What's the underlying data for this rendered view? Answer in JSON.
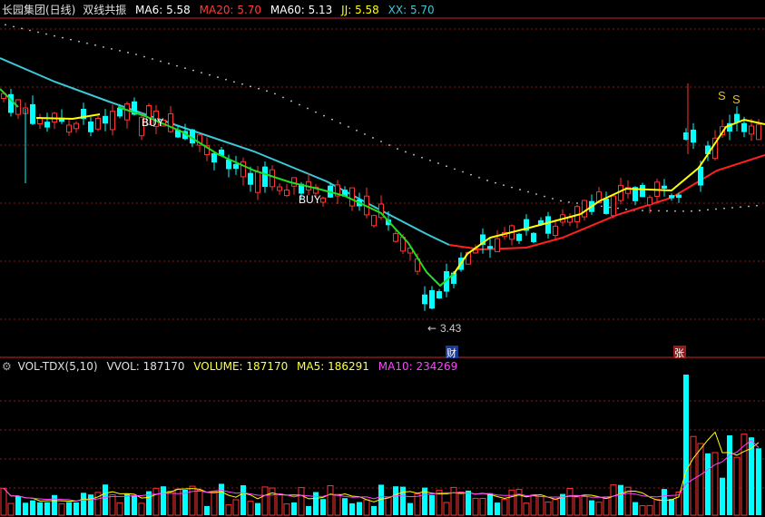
{
  "price_panel": {
    "stock_name": "长园集团(日线)",
    "indicator_name": "双线共振",
    "ma6": {
      "label": "MA6: 5.58",
      "color": "#ffffff"
    },
    "ma20": {
      "label": "MA20: 5.70",
      "color": "#ff3b3b"
    },
    "ma60": {
      "label": "MA60: 5.13",
      "color": "#ffffff"
    },
    "jj": {
      "label": "JJ: 5.58",
      "color": "#ffff00"
    },
    "xx": {
      "label": "XX: 5.70",
      "color": "#3cc8d8"
    },
    "low_marker": "3.43",
    "buy_label_1": "BUY",
    "buy_label_2": "BUY",
    "sell_label_1": "S",
    "sell_label_2": "S",
    "event_tag_1": "财",
    "event_tag_2": "张"
  },
  "volume_panel": {
    "indicator_name": "VOL-TDX(5,10)",
    "vvol": "VVOL: 187170",
    "volume": "VOLUME: 187170",
    "ma5": "MA5: 186291",
    "ma10": "MA10: 234269"
  },
  "colors": {
    "up": "#ff3232",
    "down": "#00ffff",
    "ma60_dots": "#d0d0d0",
    "jj_line_up": "#ffff00",
    "jj_line_down": "#22dd22",
    "xx_line_up": "#ff2020",
    "xx_line_down": "#3cc8d8",
    "vol_ma5": "#ffff00",
    "vol_ma10": "#ff44ff",
    "grid": "#8b1a1a",
    "divider": "#c82828"
  },
  "chart_data": {
    "type": "candlestick",
    "symbol": "长园集团",
    "period": "日线",
    "y_low_marked": 3.43,
    "series": [
      {
        "name": "MA6",
        "last": 5.58
      },
      {
        "name": "MA20",
        "last": 5.7
      },
      {
        "name": "MA60",
        "last": 5.13
      },
      {
        "name": "JJ",
        "last": 5.58
      },
      {
        "name": "XX",
        "last": 5.7
      }
    ],
    "volume": {
      "vvol": 187170,
      "volume": 187170,
      "ma5": 186291,
      "ma10": 234269
    }
  }
}
